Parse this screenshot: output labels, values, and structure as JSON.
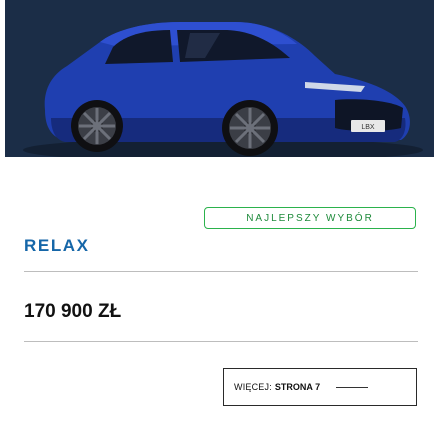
{
  "card": {
    "badge": "NAJLEPSZY WYBÓR",
    "trim_name": "RELAX",
    "price": "170 900 ZŁ",
    "more_label": "WIĘCEJ:",
    "more_page": "STRONA 7",
    "plate_text": "LBX"
  },
  "colors": {
    "hero_bg": "#1b2d47",
    "car_body": "#1f3fb0",
    "trim_color": "#1566a8",
    "badge_border": "#2bb24c"
  },
  "icons": [
    "car-image",
    "arrow-line-icon"
  ]
}
